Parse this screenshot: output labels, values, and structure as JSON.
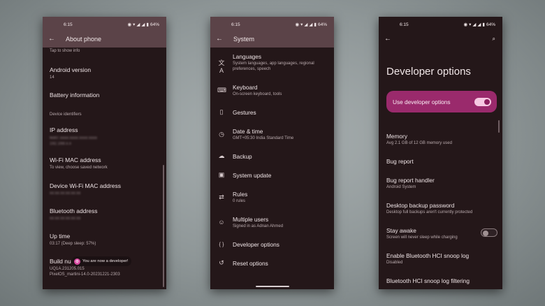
{
  "left_phone": {
    "status": {
      "time": "6:15",
      "battery": "64%"
    },
    "title": "About phone",
    "tap_hint": "Tap to show info",
    "android_version": {
      "title": "Android version",
      "value": "14"
    },
    "battery_info": {
      "title": "Battery information"
    },
    "section_label": "Device identifiers",
    "ip_address": {
      "title": "IP address",
      "value_line1": "fe80::xxxx:xxxx:xxxx:xxxx",
      "value_line2": "192.168.x.x"
    },
    "wifi_mac": {
      "title": "Wi-Fi MAC address",
      "sub": "To view, choose saved network"
    },
    "device_wifi_mac": {
      "title": "Device Wi-Fi MAC address",
      "value": "xx:xx:xx:xx:xx:xx"
    },
    "bluetooth": {
      "title": "Bluetooth address",
      "value": "xx:xx:xx:xx:xx:xx"
    },
    "uptime": {
      "title": "Up time",
      "value": "03:17 (Deep sleep: 57%)"
    },
    "build": {
      "title": "Build nu",
      "line1": "UQ1A.231205.015",
      "line2": "PixelOS_martini-14.0-20231221-2303"
    },
    "toast": "You are now a developer!"
  },
  "middle_phone": {
    "status": {
      "time": "6:15",
      "battery": "64%"
    },
    "title": "System",
    "items": [
      {
        "icon": "translate-icon",
        "glyph": "文A",
        "title": "Languages",
        "sub": "System languages, app languages, regional preferences, speech"
      },
      {
        "icon": "keyboard-icon",
        "glyph": "⌨",
        "title": "Keyboard",
        "sub": "On-screen keyboard, tools"
      },
      {
        "icon": "gestures-icon",
        "glyph": "▯",
        "title": "Gestures",
        "sub": ""
      },
      {
        "icon": "clock-icon",
        "glyph": "◷",
        "title": "Date & time",
        "sub": "GMT+05:30 India Standard Time"
      },
      {
        "icon": "backup-icon",
        "glyph": "☁",
        "title": "Backup",
        "sub": ""
      },
      {
        "icon": "system-update-icon",
        "glyph": "▣",
        "title": "System update",
        "sub": ""
      },
      {
        "icon": "rules-icon",
        "glyph": "⇄",
        "title": "Rules",
        "sub": "0 rules"
      },
      {
        "icon": "users-icon",
        "glyph": "☺",
        "title": "Multiple users",
        "sub": "Signed in as Adnan Ahmed"
      },
      {
        "icon": "developer-icon",
        "glyph": "{ }",
        "title": "Developer options",
        "sub": ""
      },
      {
        "icon": "reset-icon",
        "glyph": "↺",
        "title": "Reset options",
        "sub": ""
      }
    ]
  },
  "right_phone": {
    "status": {
      "time": "6:15",
      "battery": "64%"
    },
    "title": "Developer options",
    "master_toggle": {
      "label": "Use developer options",
      "on": true
    },
    "items": [
      {
        "title": "Memory",
        "sub": "Avg 2.1 GB of 12 GB memory used"
      },
      {
        "title": "Bug report",
        "sub": ""
      },
      {
        "title": "Bug report handler",
        "sub": "Android System"
      },
      {
        "title": "Desktop backup password",
        "sub": "Desktop full backups aren't currently protected"
      },
      {
        "title": "Stay awake",
        "sub": "Screen will never sleep while charging"
      },
      {
        "title": "Enable Bluetooth HCI snoop log",
        "sub": "Disabled"
      },
      {
        "title": "Bluetooth HCI snoop log filtering",
        "sub": ""
      }
    ]
  }
}
